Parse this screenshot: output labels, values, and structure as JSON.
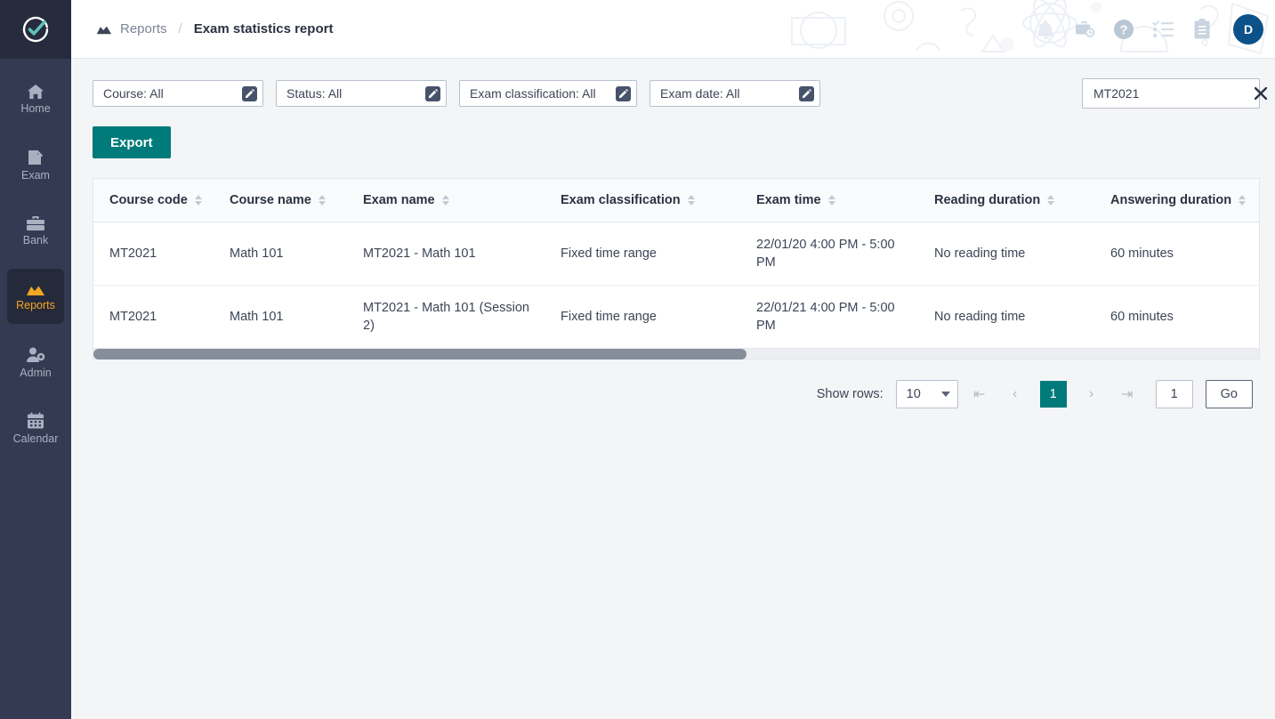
{
  "sidebar": {
    "logo_icon": "check-circle-logo",
    "items": [
      {
        "label": "Home",
        "icon": "home-icon",
        "active": false
      },
      {
        "label": "Exam",
        "icon": "exam-icon",
        "active": false
      },
      {
        "label": "Bank",
        "icon": "bank-icon",
        "active": false
      },
      {
        "label": "Reports",
        "icon": "reports-icon",
        "active": true
      },
      {
        "label": "Admin",
        "icon": "admin-icon",
        "active": false
      },
      {
        "label": "Calendar",
        "icon": "calendar-icon",
        "active": false
      }
    ]
  },
  "topbar": {
    "breadcrumb_icon": "reports-chart-icon",
    "breadcrumb_parent": "Reports",
    "breadcrumb_separator": "/",
    "breadcrumb_current": "Exam statistics report",
    "icons": [
      {
        "name": "bell-icon"
      },
      {
        "name": "briefcase-clock-icon"
      },
      {
        "name": "help-circle-icon"
      },
      {
        "name": "checklist-icon"
      },
      {
        "name": "clipboard-icon"
      }
    ],
    "avatar_initial": "D"
  },
  "filters": [
    {
      "label": "Course: All",
      "edit_icon": "edit-pencil-icon"
    },
    {
      "label": "Status: All",
      "edit_icon": "edit-pencil-icon"
    },
    {
      "label": "Exam classification: All",
      "edit_icon": "edit-pencil-icon"
    },
    {
      "label": "Exam date: All",
      "edit_icon": "edit-pencil-icon"
    }
  ],
  "search": {
    "value": "MT2021",
    "placeholder": "Search",
    "clear_icon": "close-x-icon"
  },
  "actions": {
    "export_label": "Export"
  },
  "table": {
    "columns": [
      "Course code",
      "Course name",
      "Exam name",
      "Exam classification",
      "Exam time",
      "Reading duration",
      "Answering duration"
    ],
    "rows": [
      {
        "course_code": "MT2021",
        "course_name": "Math 101",
        "exam_name": "MT2021 - Math 101",
        "exam_classification": "Fixed time range",
        "exam_time": "22/01/20 4:00 PM - 5:00 PM",
        "reading_duration": "No reading time",
        "answering_duration": "60 minutes"
      },
      {
        "course_code": "MT2021",
        "course_name": "Math 101",
        "exam_name": "MT2021 - Math 101 (Session 2)",
        "exam_classification": "Fixed time range",
        "exam_time": "22/01/21 4:00 PM - 5:00 PM",
        "reading_duration": "No reading time",
        "answering_duration": "60 minutes"
      }
    ]
  },
  "pagination": {
    "show_rows_label": "Show rows:",
    "rows_per_page": "10",
    "first_icon": "first-page-icon",
    "prev_icon": "prev-page-icon",
    "current_page": "1",
    "next_icon": "next-page-icon",
    "last_icon": "last-page-icon",
    "goto_value": "1",
    "go_label": "Go"
  },
  "colors": {
    "sidebar_bg": "#343a52",
    "sidebar_active_bg": "#252a3b",
    "sidebar_active_fg": "#f5a623",
    "accent_teal": "#007a7a",
    "avatar_blue": "#0d5189",
    "page_bg": "#f4f5f7"
  }
}
